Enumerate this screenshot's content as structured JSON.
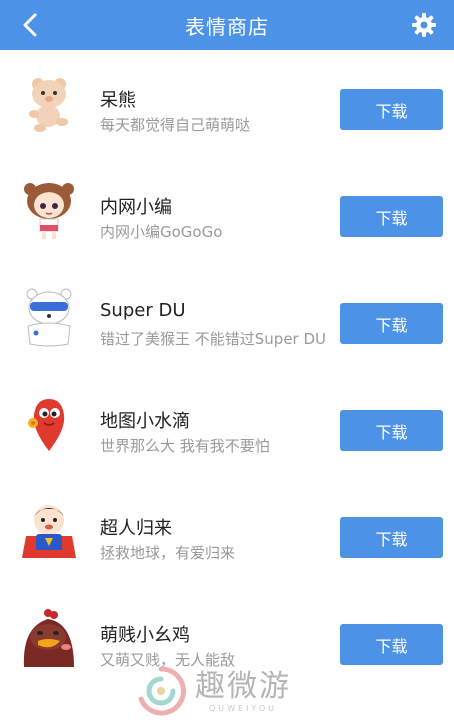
{
  "header": {
    "title": "表情商店",
    "back_icon": "chevron-left-icon",
    "settings_icon": "gear-icon"
  },
  "colors": {
    "accent": "#4c93e8",
    "title_text": "#222222",
    "desc_text": "#9a9a9a"
  },
  "stickers": [
    {
      "name": "呆熊",
      "desc": "每天都觉得自己萌萌哒",
      "button": "下载",
      "icon": "bear-avatar"
    },
    {
      "name": "内网小编",
      "desc": "内网小编GoGoGo",
      "button": "下载",
      "icon": "girl-avatar"
    },
    {
      "name": "Super DU",
      "desc": "错过了美猴王 不能错过Super DU",
      "button": "下载",
      "icon": "du-bear-avatar"
    },
    {
      "name": "地图小水滴",
      "desc": "世界那么大 我有我不要怕",
      "button": "下载",
      "icon": "water-drop-avatar"
    },
    {
      "name": "超人归来",
      "desc": "拯救地球，有爱归来",
      "button": "下载",
      "icon": "superman-avatar"
    },
    {
      "name": "萌贱小幺鸡",
      "desc": "又萌又贱，无人能敌",
      "button": "下载",
      "icon": "chicken-avatar"
    }
  ],
  "watermark": {
    "text": "趣微游",
    "sub": "QUWEIYOU"
  }
}
